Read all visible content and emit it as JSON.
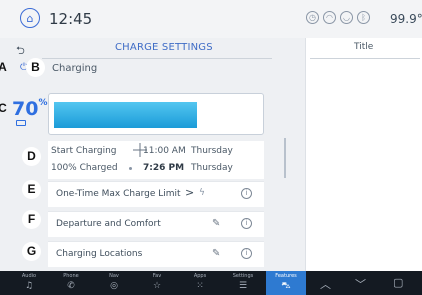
{
  "status_bar": {
    "time": "12:45",
    "outside_temp": "99.9°",
    "status_icons": [
      "clock-icon",
      "wifi-icon",
      "profile-icon",
      "bluetooth-icon"
    ]
  },
  "screen": {
    "title": "CHARGE SETTINGS",
    "status": "Charging",
    "battery_percent": "70",
    "battery_unit": "%",
    "charge_level": 0.7
  },
  "schedule": {
    "start_label": "Start Charging",
    "start_time": "11:00 AM",
    "start_day": "Thursday",
    "done_label": "100% Charged",
    "done_time": "7:26 PM",
    "done_day": "Thursday"
  },
  "rows": [
    {
      "label": "One-Time Max Charge Limit",
      "arrow": ">"
    },
    {
      "label": "Departure and Comfort"
    },
    {
      "label": "Charging Locations"
    }
  ],
  "right_panel": {
    "title": "Title"
  },
  "annotations": [
    "A",
    "B",
    "C",
    "D",
    "E",
    "F",
    "G"
  ],
  "nav": [
    {
      "label": "Audio",
      "icon": "music-icon"
    },
    {
      "label": "Phone",
      "icon": "phone-icon"
    },
    {
      "label": "Nav",
      "icon": "compass-icon"
    },
    {
      "label": "Fav",
      "icon": "star-icon"
    },
    {
      "label": "Apps",
      "icon": "grid-icon"
    },
    {
      "label": "Settings",
      "icon": "sliders-icon"
    },
    {
      "label": "Features",
      "icon": "car-icon",
      "active": true
    }
  ],
  "colors": {
    "accent": "#2f6fe0",
    "fill": "#1a9bd8",
    "nav_active": "#2e7ad1",
    "nav_bg": "#141a22"
  }
}
